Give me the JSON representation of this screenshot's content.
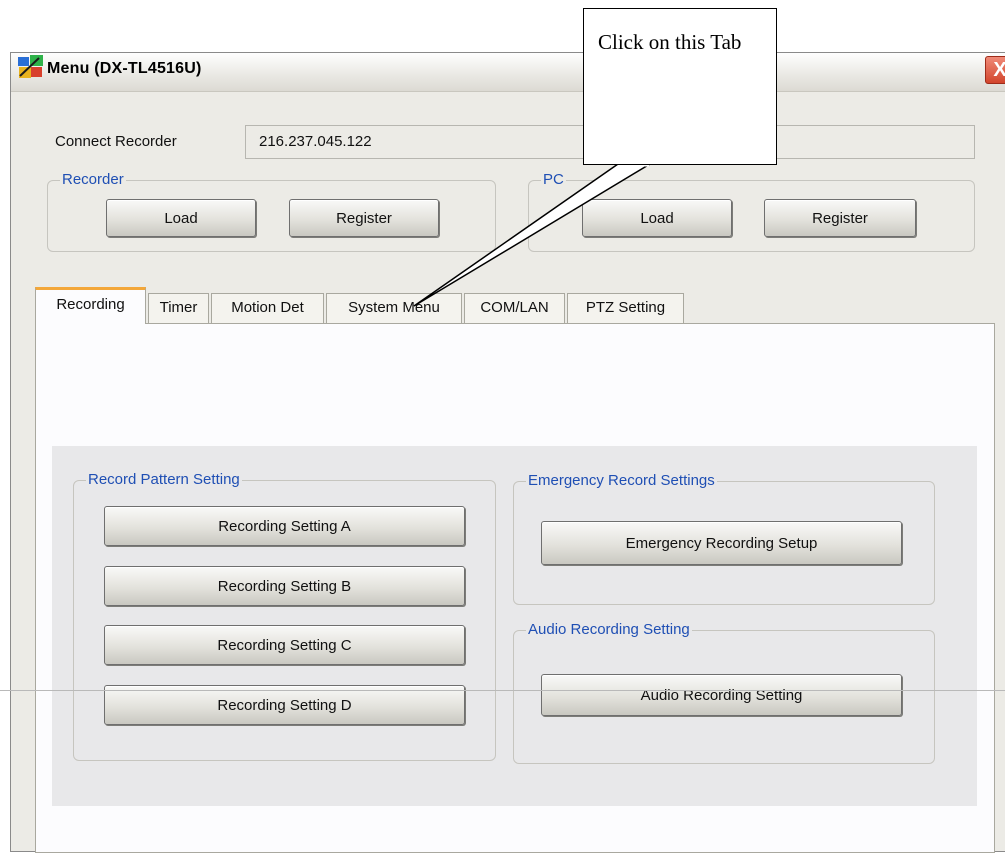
{
  "window": {
    "title": "Menu (DX-TL4516U)",
    "close_glyph": "X",
    "app_icon": "app-logo-icon"
  },
  "connection": {
    "label": "Connect Recorder",
    "address": "216.237.045.122"
  },
  "recorder_group": {
    "legend": "Recorder",
    "load_label": "Load",
    "register_label": "Register"
  },
  "pc_group": {
    "legend": "PC",
    "load_label": "Load",
    "register_label": "Register"
  },
  "tabs": [
    {
      "label": "Recording",
      "active": true
    },
    {
      "label": "Timer",
      "active": false
    },
    {
      "label": "Motion Det",
      "active": false
    },
    {
      "label": "System Menu",
      "active": false
    },
    {
      "label": "COM/LAN",
      "active": false
    },
    {
      "label": "PTZ Setting",
      "active": false
    }
  ],
  "record_pattern": {
    "legend": "Record Pattern Setting",
    "buttons": [
      "Recording Setting A",
      "Recording Setting B",
      "Recording Setting C",
      "Recording Setting D"
    ]
  },
  "emergency": {
    "legend": "Emergency Record Settings",
    "button": "Emergency Recording Setup"
  },
  "audio": {
    "legend": "Audio Recording Setting",
    "button": "Audio Recording Setting"
  },
  "callout": {
    "text": "Click on this Tab"
  },
  "colors": {
    "legend_blue": "#1f4fb4",
    "active_tab_accent": "#f3a73a",
    "close_red": "#d2452c"
  }
}
